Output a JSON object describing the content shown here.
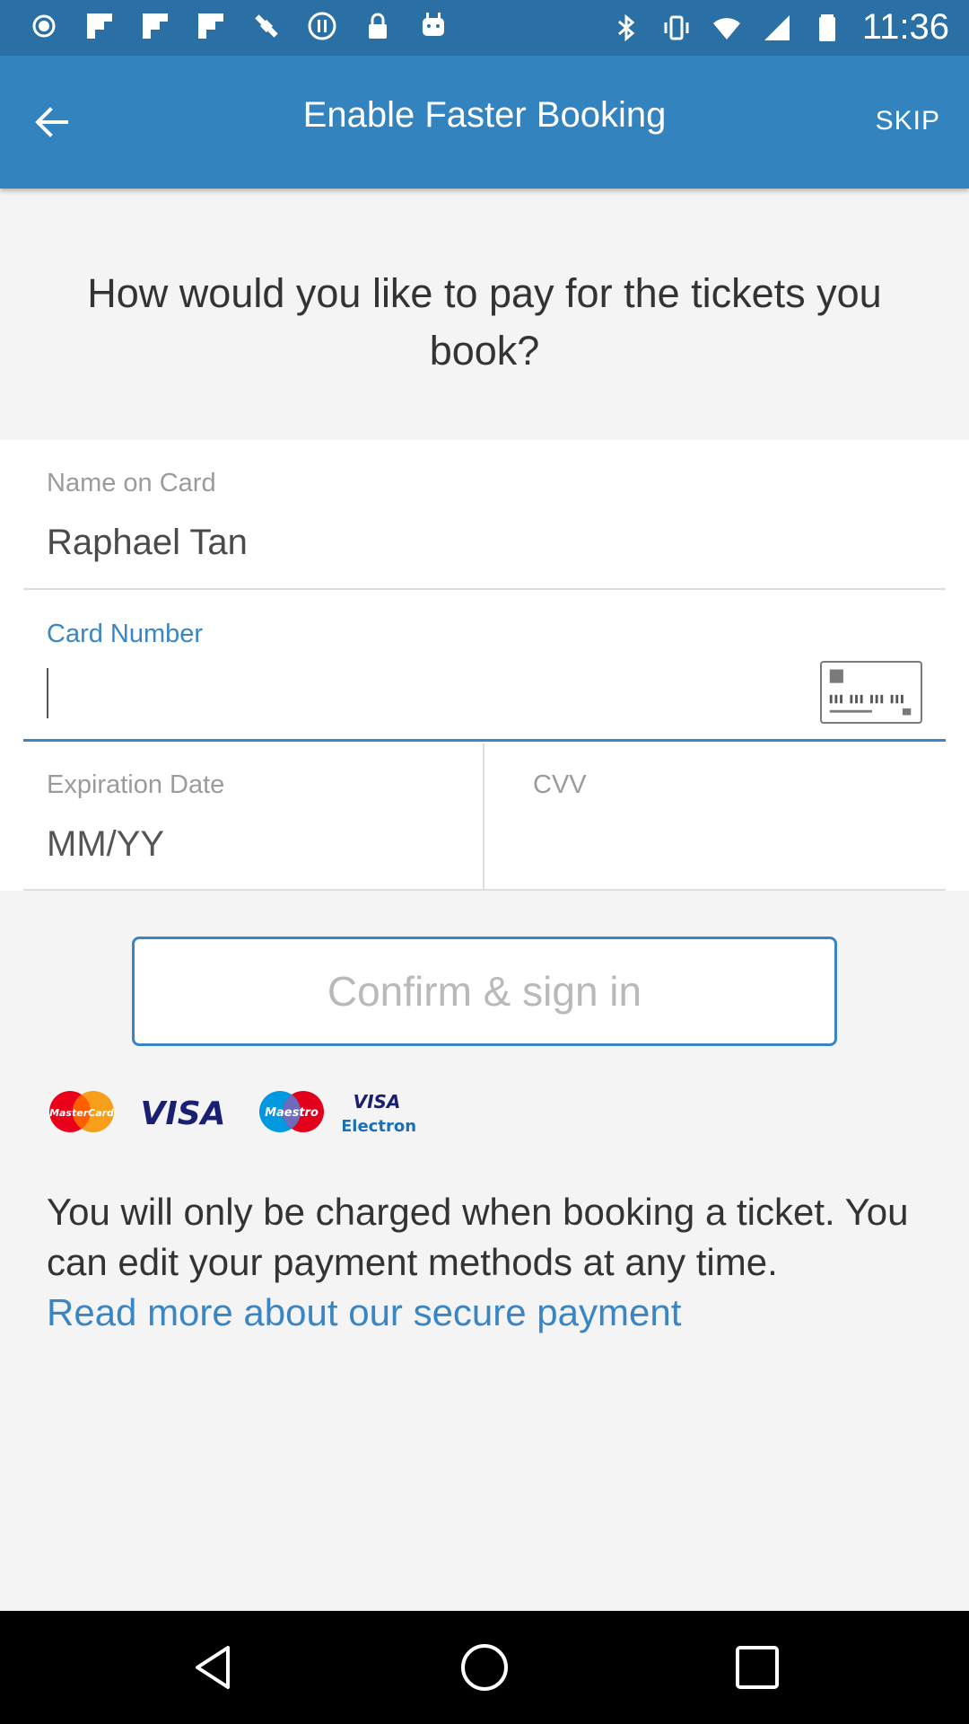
{
  "status_bar": {
    "time": "11:36",
    "left_icons": [
      "notification-dot-icon",
      "flipboard-icon",
      "flipboard-icon",
      "flipboard-icon",
      "fake-gps-icon",
      "pause-circle-icon",
      "lock-icon",
      "android-icon"
    ],
    "right_icons": [
      "bluetooth-icon",
      "vibrate-icon",
      "wifi-icon",
      "signal-icon",
      "battery-icon"
    ]
  },
  "app_bar": {
    "title": "Enable Faster Booking",
    "skip_label": "SKIP",
    "back_icon": "arrow-back-icon"
  },
  "prompt": "How would you like to pay for the tickets you book?",
  "form": {
    "name_label": "Name on Card",
    "name_value": "Raphael Tan",
    "card_number_label": "Card Number",
    "card_number_value": "",
    "expiration_label": "Expiration Date",
    "expiration_placeholder": "MM/YY",
    "cvv_label": "CVV",
    "cvv_value": ""
  },
  "confirm_label": "Confirm & sign in",
  "card_logos": {
    "mastercard": "MasterCard",
    "visa": "VISA",
    "maestro": "Maestro",
    "visa_electron_top": "VISA",
    "visa_electron_bottom": "Electron"
  },
  "info": {
    "line1": "You will only be charged when booking a ticket. You can edit your payment methods at any time.",
    "link": "Read more about our secure payment"
  },
  "colors": {
    "status_bar": "#2a70a4",
    "app_bar": "#3383bf",
    "accent": "#3a86c4"
  }
}
